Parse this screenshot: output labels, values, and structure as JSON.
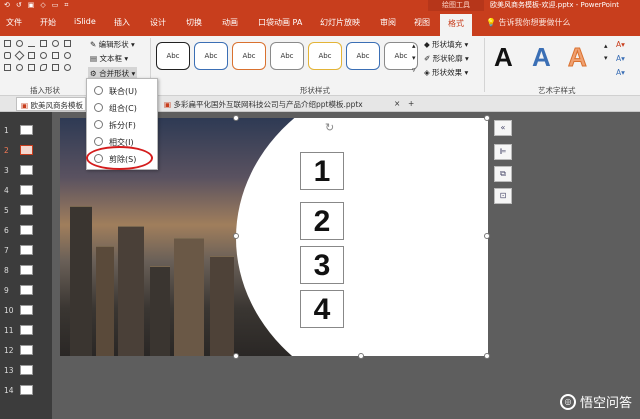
{
  "titlebar": {
    "quick": [
      "⟲",
      "↺",
      "▣",
      "◇",
      "▭",
      "⌗"
    ],
    "context_tab": "绘图工具",
    "title": "欧美风商务模板-欢迎.pptx - PowerPoint"
  },
  "tabs": [
    "文件",
    "开始",
    "iSlide",
    "插入",
    "设计",
    "切换",
    "动画",
    "口袋动画 PA",
    "幻灯片放映",
    "审阅",
    "视图",
    "格式"
  ],
  "active_tab": "格式",
  "help_text": "告诉我你想要做什么",
  "ribbon": {
    "edit_shape": "编辑形状",
    "text_box": "文本框",
    "merge_shapes": "合并形状",
    "insert_shapes_group": "插入形状",
    "shape_styles_group": "形状样式",
    "shape_fill": "形状填充",
    "shape_outline": "形状轮廓",
    "shape_effects": "形状效果",
    "wordart_group": "艺术字样式",
    "abc": "Abc",
    "wordart_letter": "A",
    "style_colors": [
      "#222222",
      "#3b6fb5",
      "#d9712f",
      "#8a8a8a",
      "#e3b437",
      "#3b6fb5"
    ]
  },
  "doc_tabs": [
    "欧美风商务模板",
    "多彩扁平化国外互联网科技公司与产品介绍ppt模板.pptx"
  ],
  "merge_menu": [
    {
      "label": "联合(U)"
    },
    {
      "label": "组合(C)"
    },
    {
      "label": "拆分(F)"
    },
    {
      "label": "相交(I)"
    },
    {
      "label": "剪除(S)"
    }
  ],
  "slides": [
    "1",
    "2",
    "3",
    "4",
    "5",
    "6",
    "7",
    "8",
    "9",
    "10",
    "11",
    "12",
    "13",
    "14"
  ],
  "selected_slide": "2",
  "slide_numbers": [
    "1",
    "2",
    "3",
    "4"
  ],
  "watermark": "悟空问答"
}
